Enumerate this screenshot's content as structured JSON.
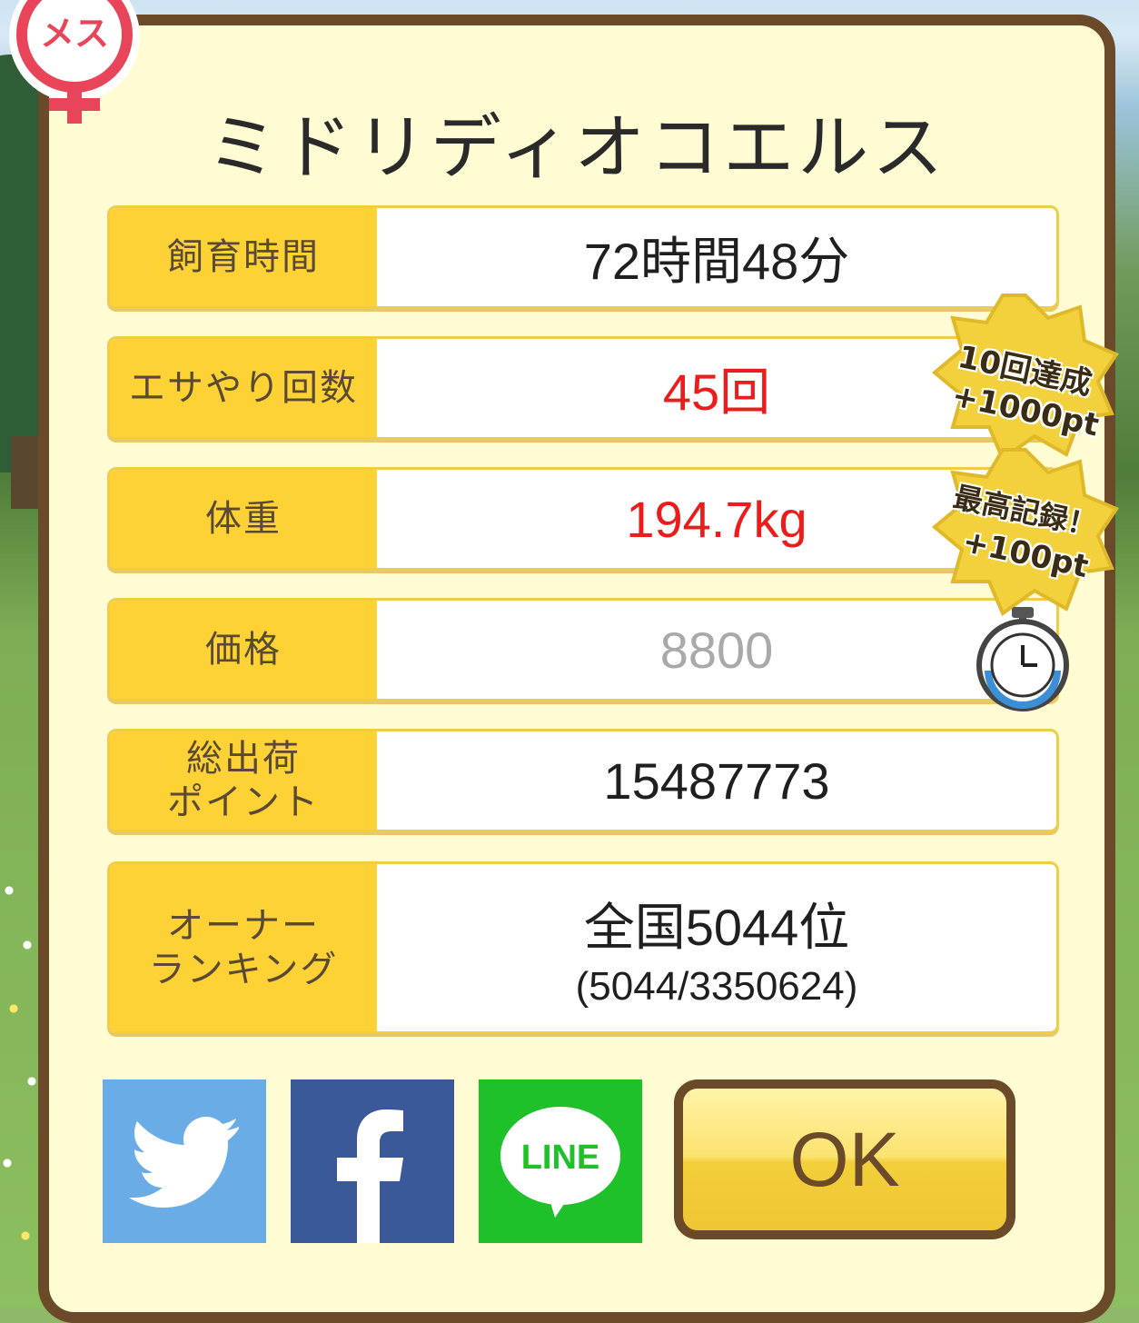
{
  "gender": "メス",
  "title": "ミドリディオコエルス",
  "rows": [
    {
      "label": "飼育時間",
      "value": "72時間48分"
    },
    {
      "label": "エサやり回数",
      "value": "45回"
    },
    {
      "label": "体重",
      "value": "194.7kg"
    },
    {
      "label": "価格",
      "value": "8800"
    },
    {
      "label": "総出荷\nポイント",
      "value": "15487773"
    },
    {
      "label": "オーナー\nランキング",
      "value": "全国5044位",
      "sub": "(5044/3350624)"
    }
  ],
  "badges": [
    {
      "line1": "10回達成",
      "line2": "+1000pt"
    },
    {
      "line1": "最高記録！",
      "line2": "+100pt"
    }
  ],
  "share": {
    "twitter_color": "#6aace6",
    "facebook_color": "#3b5998",
    "line_color": "#1fc12a",
    "line_label": "LINE"
  },
  "ok_label": "OK",
  "icons": [
    "female-symbol-icon",
    "twitter-bird-icon",
    "facebook-f-icon",
    "line-bubble-icon",
    "stopwatch-icon"
  ]
}
